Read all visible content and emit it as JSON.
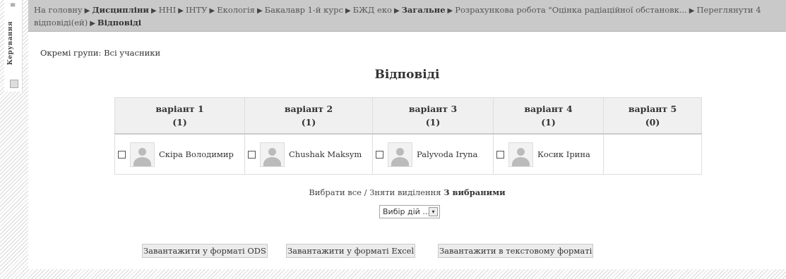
{
  "sidebar": {
    "label": "Керування",
    "menu_glyph": "≡"
  },
  "breadcrumb": [
    {
      "label": "На головну",
      "bold": false
    },
    {
      "label": "Дисципліни",
      "bold": true
    },
    {
      "label": "ННІ",
      "bold": false
    },
    {
      "label": "ІНТУ",
      "bold": false
    },
    {
      "label": "Екологія",
      "bold": false
    },
    {
      "label": "Бакалавр 1-й курс",
      "bold": false
    },
    {
      "label": "БЖД еко",
      "bold": false
    },
    {
      "label": "Загальне",
      "bold": true
    },
    {
      "label": "Розрахункова робота \"Оцінка радіаційної обстановк...",
      "bold": false
    },
    {
      "label": "Переглянути 4 відповіді(ей)",
      "bold": false
    },
    {
      "label": "Відповіді",
      "bold": false,
      "current": true
    }
  ],
  "groups_text": "Окремі групи: Всі учасники",
  "heading": "Відповіді",
  "columns": [
    {
      "label": "варіант 1",
      "count": "(1)"
    },
    {
      "label": "варіант 2",
      "count": "(1)"
    },
    {
      "label": "варіант 3",
      "count": "(1)"
    },
    {
      "label": "варіант 4",
      "count": "(1)"
    },
    {
      "label": "варіант 5",
      "count": "(0)"
    }
  ],
  "responses": [
    "Скіра Володимир",
    "Chushak Maksym",
    "Palyvoda Iryna",
    "Косик Ірина",
    ""
  ],
  "selection": {
    "select_all": "Вибрати все",
    "divider": "/",
    "deselect": "Зняти виділення",
    "with_selected": "З вибраними"
  },
  "actions_select": {
    "value": "Вибір дій ...",
    "arrow": "▾"
  },
  "downloads": {
    "ods": "Завантажити у форматі ODS",
    "excel": "Завантажити у форматі Excel",
    "text": "Завантажити в текстовому форматі"
  }
}
